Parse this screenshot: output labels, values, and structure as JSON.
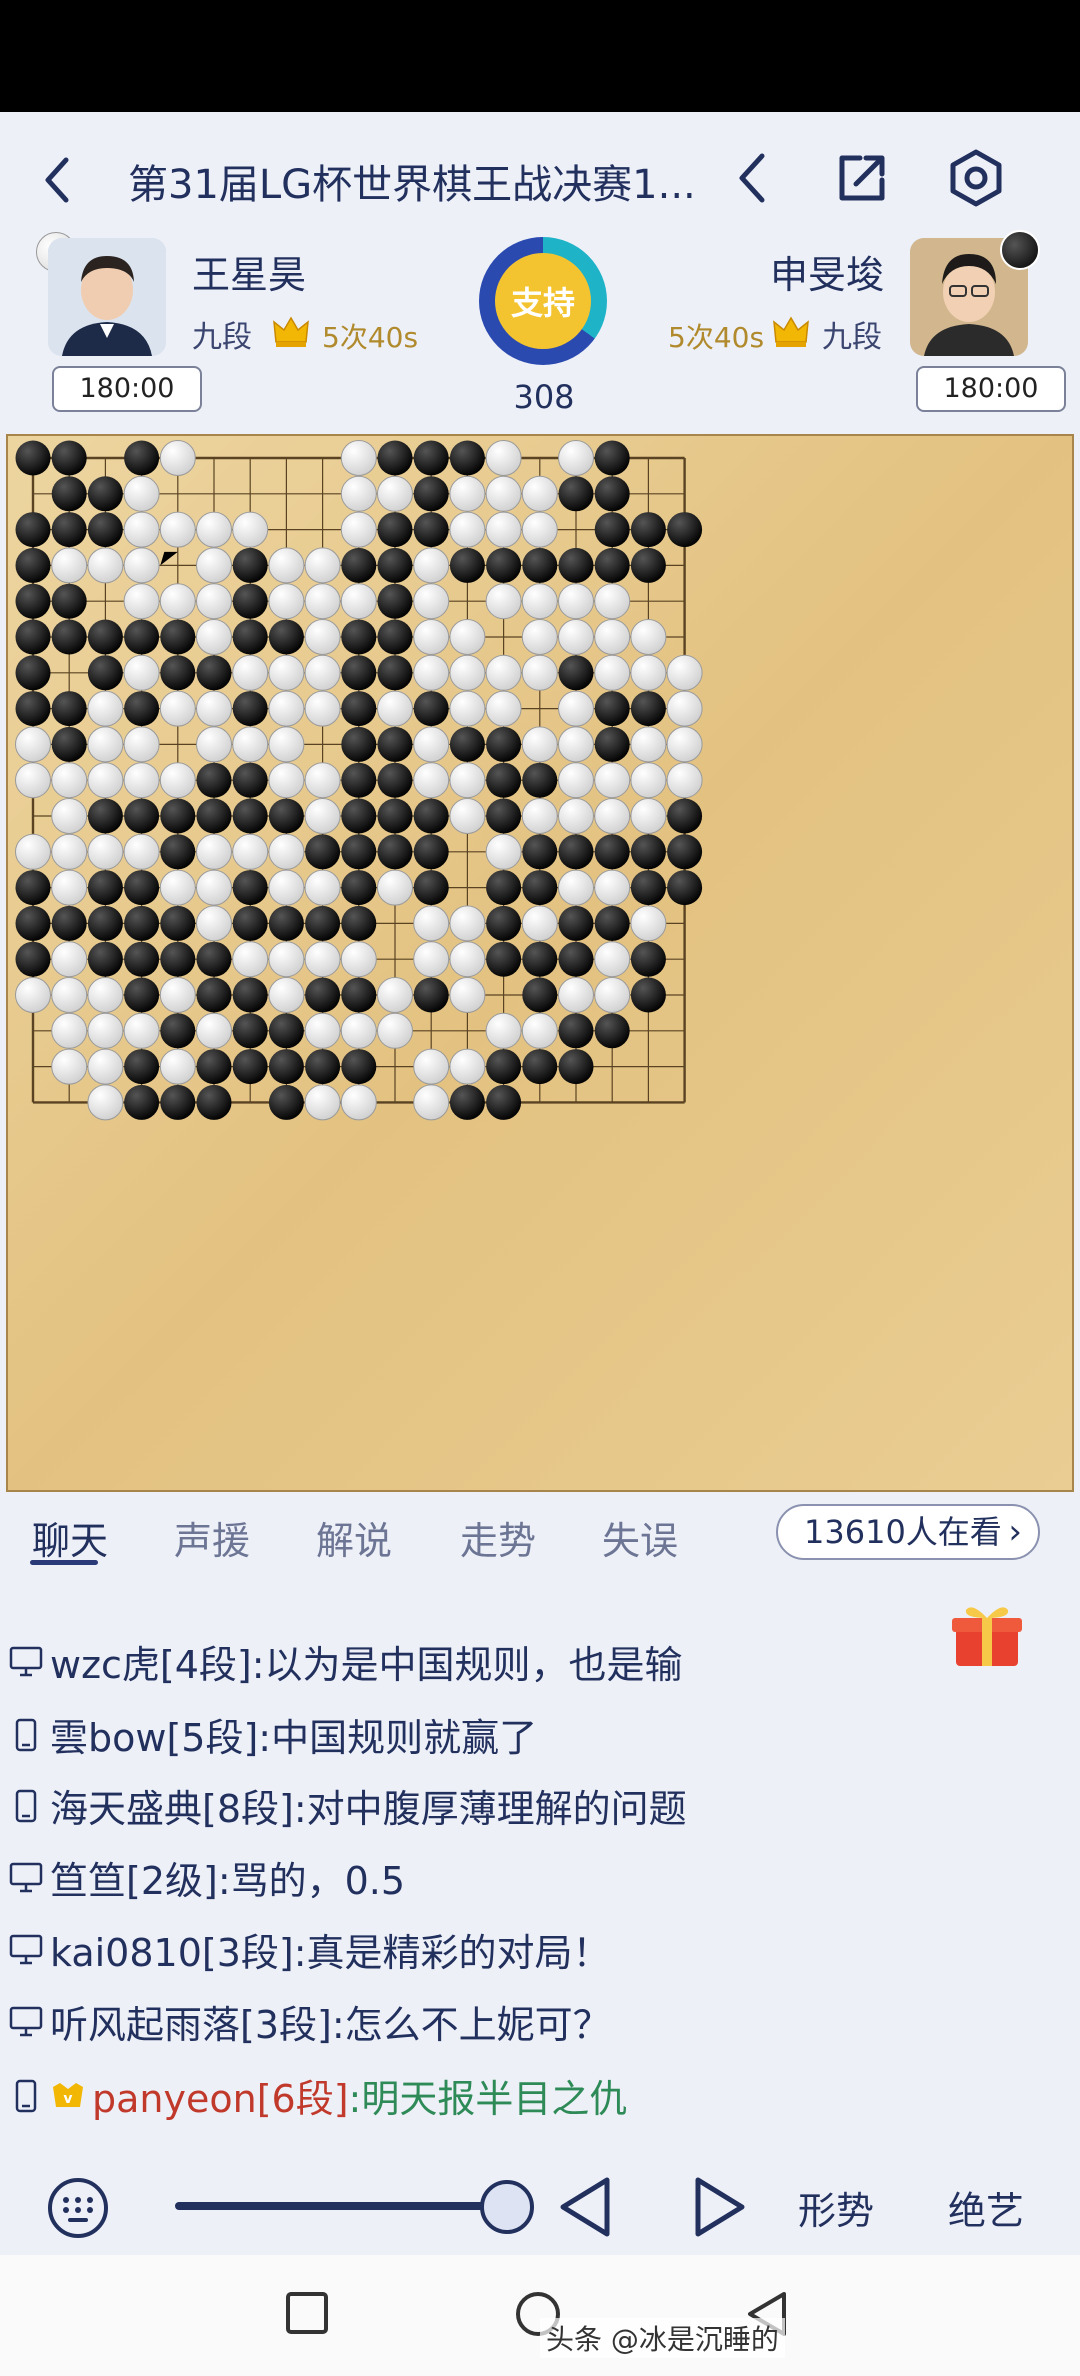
{
  "header": {
    "title": "第31届LG杯世界棋王战决赛1..."
  },
  "players": {
    "left": {
      "name": "王星昊",
      "rank": "九段",
      "byoyomi": "5次40s",
      "clock": "180:00",
      "stone": "white"
    },
    "right": {
      "name": "申旻埈",
      "rank": "九段",
      "byoyomi": "5次40s",
      "clock": "180:00",
      "stone": "black"
    }
  },
  "center": {
    "support_label": "支持",
    "move_count": "308"
  },
  "board": {
    "size": 19,
    "rows": [
      "BB.BW....WBBBW.WB..",
      ".BBW.....WWBWWWBB..",
      "BBBWWWW..WBBWWW.BBB",
      "BWWW.WBWWBBWBBBBBB.",
      "BB.WWWBWWWBW.WWWW..",
      "BBBBBWBBWBBWW.WWWW.",
      "B.BWBBWWWBBWWWWBWWW",
      "BBWBWWBWWBWBWW.WBBW",
      "WBWW.WWW.BBWBBWWBWW",
      "WWWWWBBWWBBWWBBWWWW",
      ".WBBBBBBWBBBWBWWWWB",
      "WWWWBWWWBBBB.WBBBBB",
      "BWBBWWBWWBWB.BBWWBB",
      "BBBBBWBBBB.WWBWBBW.",
      "BWBBBBWWWW.WWBBBWB.",
      "WWWBWBBWBBWBW.BWWB.",
      ".WWWBWBBWWW..WWBB..",
      ".WWBWBBBBB.WWBBB...",
      "..WBBB.BWW.WBB....."
    ],
    "last_move": [
      4,
      3
    ]
  },
  "tabs": [
    {
      "label": "聊天",
      "active": true
    },
    {
      "label": "声援",
      "active": false
    },
    {
      "label": "解说",
      "active": false
    },
    {
      "label": "走势",
      "active": false
    },
    {
      "label": "失误",
      "active": false
    }
  ],
  "viewers": "13610人在看",
  "chat": [
    {
      "device": "desktop",
      "user": "wzc虎[4段]",
      "text": ":以为是中国规则，也是输"
    },
    {
      "device": "mobile",
      "user": "雲bow[5段]",
      "text": ":中国规则就赢了"
    },
    {
      "device": "mobile",
      "user": "海天盛典[8段]",
      "text": ":对中腹厚薄理解的问题"
    },
    {
      "device": "desktop",
      "user": "笪笪[2级]",
      "text": ":骂的，0.5"
    },
    {
      "device": "desktop",
      "user": "kai0810[3段]",
      "text": ":真是精彩的对局！"
    },
    {
      "device": "desktop",
      "user": "听风起雨落[3段]",
      "text": ":怎么不上妮可？"
    },
    {
      "device": "mobile",
      "user": "panyeon[6段]",
      "text": ":明天报半目之仇",
      "vip": true
    }
  ],
  "bottom": {
    "situation_label": "形势",
    "skill_label": "绝艺"
  },
  "watermark": "头条 @冰是沉睡的",
  "colors": {
    "accent": "#22305e",
    "board": "#e6c687",
    "vip_name": "#c0392b",
    "vip_text": "#2e8b57"
  }
}
